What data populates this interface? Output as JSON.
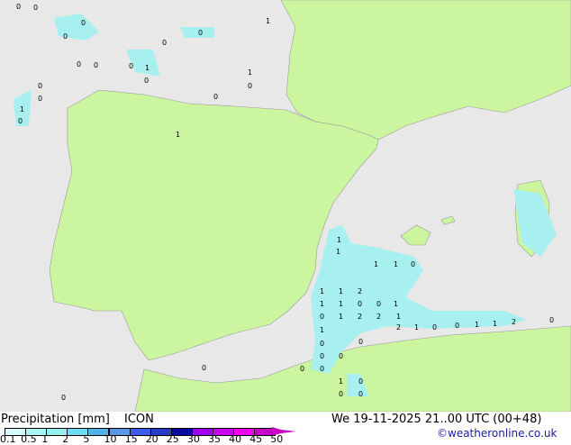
{
  "title": "Precipitation [mm]",
  "model": "ICON",
  "datetime": "We 19-11-2025 21..00 UTC (00+48)",
  "credit": "©weatheronline.co.uk",
  "scale": {
    "ticks": [
      "0.1",
      "0.5",
      "1",
      "2",
      "5",
      "10",
      "15",
      "20",
      "25",
      "30",
      "35",
      "40",
      "45",
      "50"
    ],
    "colors": [
      "#d2fafa",
      "#aaf5f5",
      "#96f0f0",
      "#6edcf0",
      "#50b4e6",
      "#5a96e6",
      "#3c5af0",
      "#283cc8",
      "#0a0aa0",
      "#a000f0",
      "#c800f0",
      "#f000f0",
      "#c800c8"
    ]
  },
  "colors": {
    "sea": "#e8e8e8",
    "land": "#ccf5a0",
    "rain": "#a8f0f0"
  },
  "map_values": [
    "0",
    "0",
    "0",
    "0",
    "0",
    "0",
    "1",
    "0",
    "0",
    "0",
    "0",
    "0",
    "1",
    "0",
    "0",
    "1",
    "0",
    "0",
    "1",
    "1",
    "1",
    "1",
    "1",
    "0",
    "1",
    "1",
    "1",
    "2",
    "0",
    "1",
    "1",
    "1",
    "0",
    "0",
    "1",
    "2",
    "2",
    "1",
    "1",
    "0",
    "0",
    "1",
    "1",
    "2",
    "2",
    "0",
    "1",
    "0",
    "0",
    "0",
    "0",
    "0",
    "0",
    "1",
    "0",
    "0",
    "0",
    "0",
    "0"
  ]
}
